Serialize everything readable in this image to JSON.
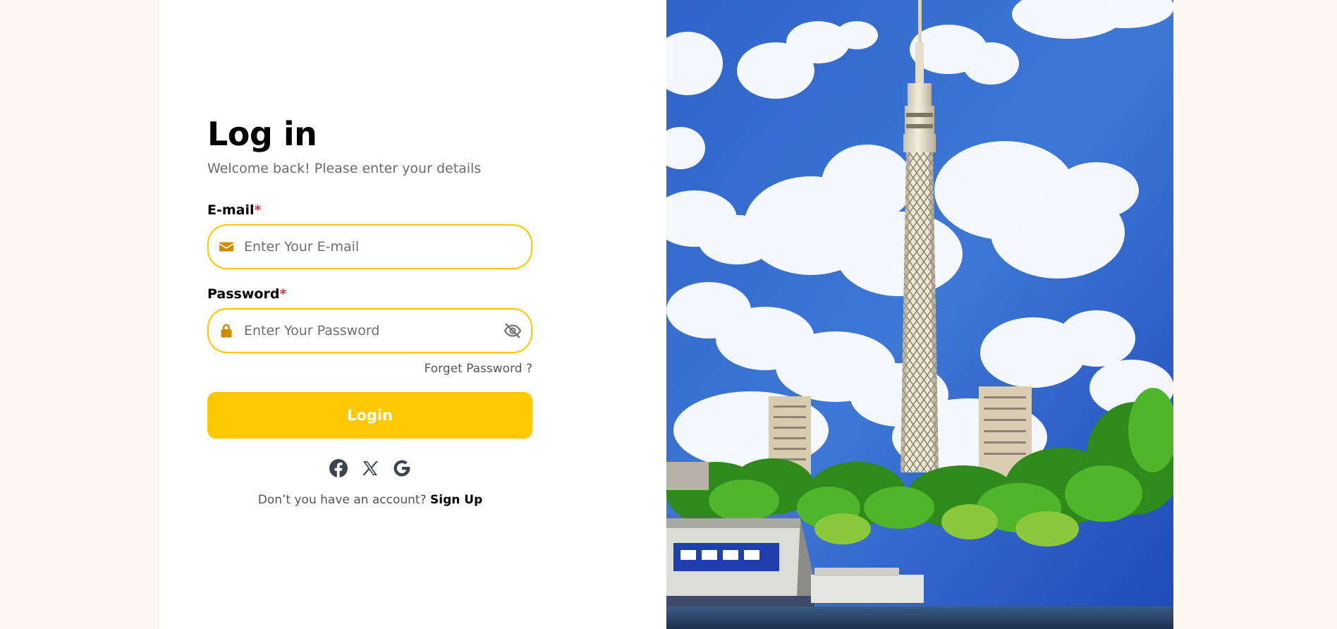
{
  "login": {
    "title": "Log in",
    "subtitle": "Welcome back! Please enter your details",
    "email_label": "E-mail",
    "email_required": "*",
    "email_placeholder": "Enter Your E-mail",
    "email_value": "",
    "password_label": "Password",
    "password_required": "*",
    "password_placeholder": "Enter Your Password",
    "password_value": "",
    "forgot_link": "Forget Password ?",
    "login_button": "Login",
    "signup_prompt": "Don’t you have an account?",
    "signup_link": "Sign Up"
  },
  "social": [
    "facebook-icon",
    "x-icon",
    "google-icon"
  ],
  "icons": {
    "email": "envelope-icon",
    "password": "lock-icon",
    "toggle_visibility": "eye-slash-icon"
  },
  "colors": {
    "accent": "#ffc800",
    "icon": "#d18b00",
    "required": "#e0303d",
    "page_bg": "#fdf8f1",
    "card_bg": "#ffffff"
  }
}
